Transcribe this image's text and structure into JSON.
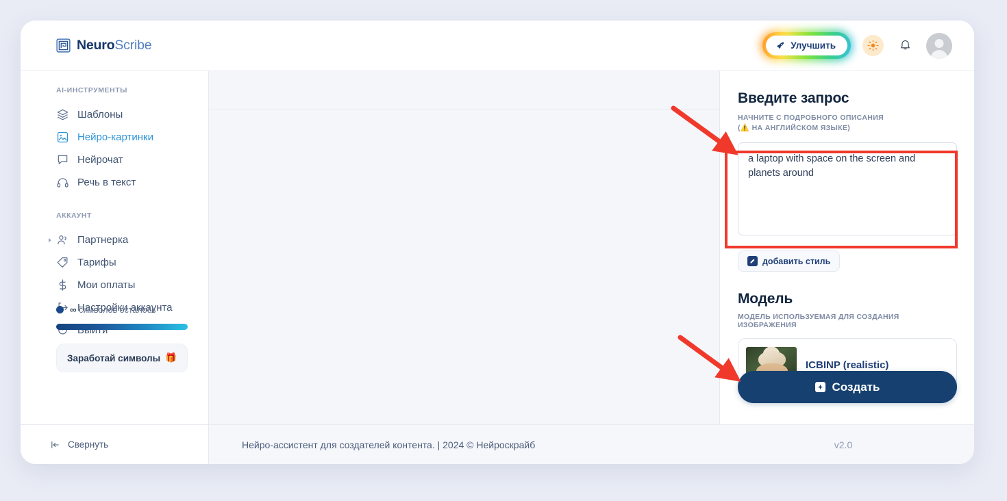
{
  "brand": {
    "name_bold": "Neuro",
    "name_light": "Scribe",
    "logo_icon": "nested-square-logo-icon"
  },
  "topbar": {
    "upgrade_label": "Улучшить",
    "upgrade_icon": "rocket-icon",
    "theme_icon": "sun-icon",
    "notifications_icon": "bell-icon",
    "avatar_icon": "user-avatar-icon"
  },
  "sidebar": {
    "sections": [
      {
        "label": "AI-ИНСТРУМЕНТЫ",
        "items": [
          {
            "label": "Шаблоны",
            "icon": "layers-icon",
            "active": false,
            "caret": false
          },
          {
            "label": "Нейро-картинки",
            "icon": "image-icon",
            "active": true,
            "caret": false
          },
          {
            "label": "Нейрочат",
            "icon": "chat-bubble-icon",
            "active": false,
            "caret": false
          },
          {
            "label": "Речь в текст",
            "icon": "headphones-icon",
            "active": false,
            "caret": false
          }
        ]
      },
      {
        "label": "АККАУНТ",
        "items": [
          {
            "label": "Партнерка",
            "icon": "users-icon",
            "active": false,
            "caret": true
          },
          {
            "label": "Тарифы",
            "icon": "tag-icon",
            "active": false,
            "caret": false
          },
          {
            "label": "Мои оплаты",
            "icon": "dollar-icon",
            "active": false,
            "caret": false
          },
          {
            "label": "Настройки аккаунта",
            "icon": "logout-bracket-icon",
            "active": false,
            "caret": false
          },
          {
            "label": "Выйти",
            "icon": "power-icon",
            "active": false,
            "caret": false
          }
        ]
      }
    ],
    "credits": {
      "amount": "∞",
      "label": "символов осталось",
      "progress_percent": 100,
      "bar_from_color": "#14427f",
      "bar_to_color": "#2bc0e4"
    },
    "earn_button": {
      "label": "Заработай символы",
      "icon": "gift-icon"
    },
    "collapse": {
      "label": "Свернуть",
      "icon": "collapse-left-icon"
    }
  },
  "right_panel": {
    "prompt_title": "Введите запрос",
    "prompt_subtitle_line1": "НАЧНИТЕ С ПОДРОБНОГО ОПИСАНИЯ",
    "prompt_subtitle_line2_prefix": "(",
    "prompt_subtitle_warning_icon": "warning-triangle-icon",
    "prompt_subtitle_line2": "НА АНГЛИЙСКОМ ЯЗЫКЕ)",
    "prompt_value": "a laptop with space on the screen and planets around",
    "prompt_placeholder": "",
    "style_button": {
      "label": "добавить стиль",
      "icon": "edit-pencil-icon"
    },
    "model_title": "Модель",
    "model_subtitle": "МОДЕЛЬ ИСПОЛЬЗУЕМАЯ ДЛЯ СОЗДАНИЯ ИЗОБРАЖЕНИЯ",
    "model_selected": {
      "name": "ICBINP (realistic)",
      "thumb": "model-preview-thumbnail"
    },
    "create_button": {
      "label": "Создать",
      "icon": "sparkle-square-icon"
    }
  },
  "footer": {
    "text": "Нейро-ассистент для создателей контента.  | 2024 © Нейроскрайб",
    "version": "v2.0"
  },
  "annotations": {
    "highlight_color": "#f0392b",
    "arrow_to_prompt": "arrow pointing to prompt textarea",
    "arrow_to_create": "arrow pointing to create button"
  }
}
